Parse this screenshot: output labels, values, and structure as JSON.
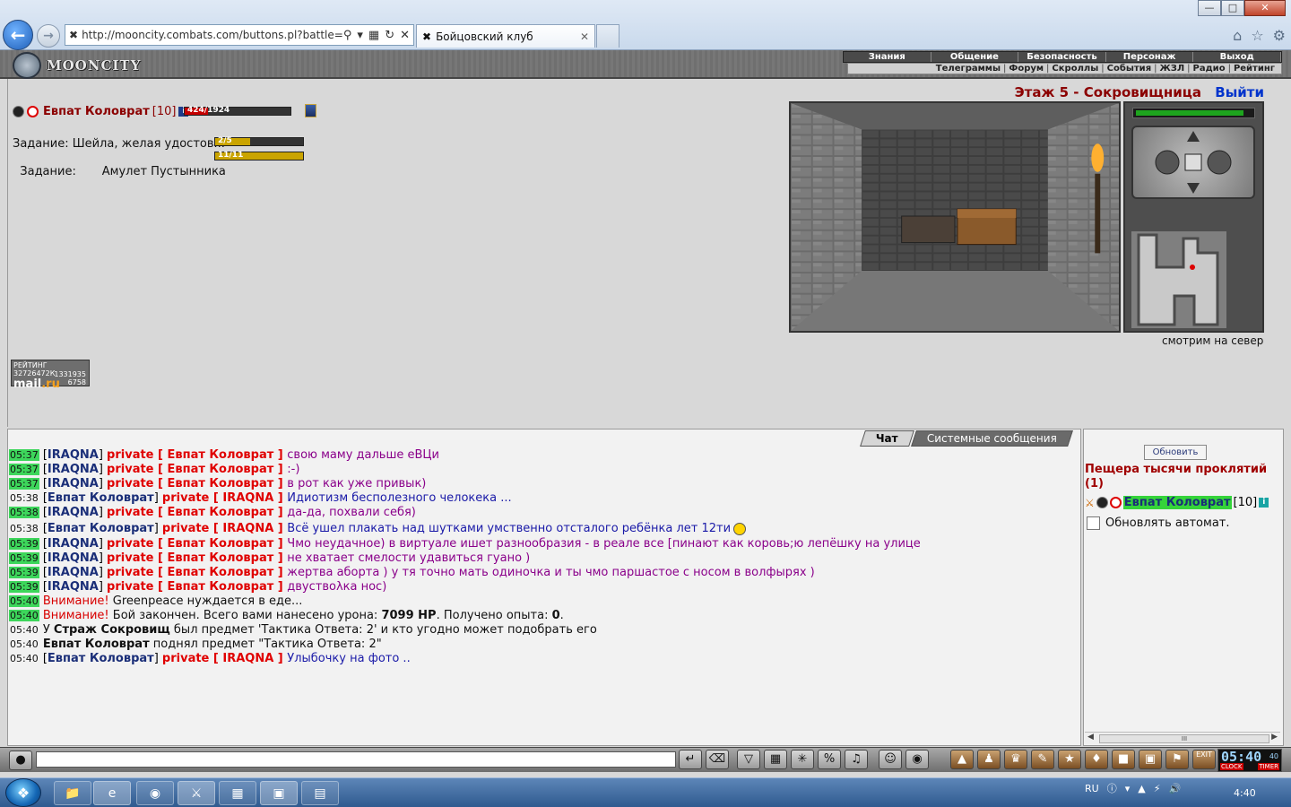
{
  "browser": {
    "url": "http://mooncity.combats.com/buttons.pl?battle=0.1",
    "tab_title": "Бойцовский клуб",
    "window_buttons": {
      "minimize": "—",
      "maximize": "□",
      "close": "✕"
    }
  },
  "game": {
    "logo_text": "MOONCITY",
    "menu_top": [
      "Знания",
      "Общение",
      "Безопасность",
      "Персонаж",
      "Выход"
    ],
    "menu_sub": [
      "Телеграммы",
      "Форум",
      "Скроллы",
      "События",
      "ЖЗЛ",
      "Радио",
      "Рейтинг"
    ],
    "location": "Этаж 5 - Сокровищница",
    "exit_label": "Выйти",
    "character": {
      "name": "Евпат Коловрат",
      "level": "[10]",
      "hp_text": "424/1924",
      "hp_fraction": 0.22
    },
    "quests": [
      {
        "label": "Задание: Шейла, желая удостов...",
        "progress_text": "2/5",
        "fraction": 0.4
      },
      {
        "label": "Задание:       Амулет Пустынника",
        "progress_text": "11/11",
        "fraction": 1.0
      }
    ],
    "look_direction": "смотрим на север",
    "counter": {
      "label": "РЕЙТИНГ 32726472К",
      "mail": "mail",
      "ru": ".ru",
      "num1": "1331935",
      "num2": "6758"
    }
  },
  "chat": {
    "tab_chat": "Чат",
    "tab_system": "Системные сообщения",
    "messages": [
      {
        "time": "05:37",
        "hl": true,
        "from": "IRAQNA",
        "private": "private",
        "to": "Евпат Коловрат",
        "text": "свою маму дальше еВЦи",
        "color": "purple"
      },
      {
        "time": "05:37",
        "hl": true,
        "from": "IRAQNA",
        "private": "private",
        "to": "Евпат Коловрат",
        "text": ":-)",
        "color": "purple"
      },
      {
        "time": "05:37",
        "hl": true,
        "from": "IRAQNA",
        "private": "private",
        "to": "Евпат Коловрат",
        "text": "в рот как уже привык)",
        "color": "purple"
      },
      {
        "time": "05:38",
        "hl": false,
        "from": "Евпат Коловрат",
        "private": "private",
        "to": "IRAQNA",
        "text": "Идиотизм бесполезного челокека ...",
        "color": "blue"
      },
      {
        "time": "05:38",
        "hl": true,
        "from": "IRAQNA",
        "private": "private",
        "to": "Евпат Коловрат",
        "text": "да-да, похвали себя)",
        "color": "purple"
      },
      {
        "time": "05:38",
        "hl": false,
        "from": "Евпат Коловрат",
        "private": "private",
        "to": "IRAQNA",
        "text": "Всё ушел плакать над шутками умственно отсталого ребёнка лет 12ти",
        "color": "blue",
        "smiley": true
      },
      {
        "time": "05:39",
        "hl": true,
        "from": "IRAQNA",
        "private": "private",
        "to": "Евпат Коловрат",
        "text": "Чмо неудачное) в виртуале ишет разнообразия - в реале все [пинают как коровь;ю лепёшку на улице",
        "color": "purple"
      },
      {
        "time": "05:39",
        "hl": true,
        "from": "IRAQNA",
        "private": "private",
        "to": "Евпат Коловрат",
        "text": "не хватает смелости удавиться гуано )",
        "color": "purple"
      },
      {
        "time": "05:39",
        "hl": true,
        "from": "IRAQNA",
        "private": "private",
        "to": "Евпат Коловрат",
        "text": "жертва аборта ) у тя точно мать одиночка и ты чмо паршастое с носом в волфырях )",
        "color": "purple"
      },
      {
        "time": "05:39",
        "hl": true,
        "from": "IRAQNA",
        "private": "private",
        "to": "Евпат Коловрат",
        "text": "двуствολка нос)",
        "color": "purple"
      }
    ],
    "system": [
      {
        "time": "05:40",
        "hl": true,
        "warn": "Внимание!",
        "text": "Greenpeace нуждается в еде..."
      },
      {
        "time": "05:40",
        "hl": true,
        "warn": "Внимание!",
        "text_a": "Бой закончен. Всего вами нанесено урона:",
        "dmg": "7099 HP",
        "text_b": ". Получено опыта:",
        "exp": "0",
        "text_c": "."
      },
      {
        "time": "05:40",
        "hl": false,
        "pre": "У",
        "who": "Страж Сокровищ",
        "text": "был предмет 'Тактика Ответа: 2' и кто угодно может подобрать его"
      },
      {
        "time": "05:40",
        "hl": false,
        "pre": "",
        "who": "Евпат Коловрат",
        "text": "поднял предмет \"Тактика Ответа: 2\""
      }
    ],
    "last": {
      "time": "05:40",
      "hl": false,
      "from": "Евпат Коловрат",
      "private": "private",
      "to": "IRAQNA",
      "text": "Улыбочку на фото ..",
      "color": "blue"
    }
  },
  "side": {
    "refresh_label": "Обновить",
    "room_name": "Пещера тысячи проклятий (1)",
    "user_name": "Евпат Коловрат",
    "user_level": "[10]",
    "auto_refresh_label": "Обновлять автомат.",
    "scroll_label": "III"
  },
  "toolbar": {
    "clock_time": "05:40",
    "clock_sec": "40",
    "clock_label": "CLOCK",
    "timer_label": "TIMER",
    "exit_label": "EXIT"
  },
  "taskbar": {
    "lang": "RU",
    "time": "4:40"
  }
}
